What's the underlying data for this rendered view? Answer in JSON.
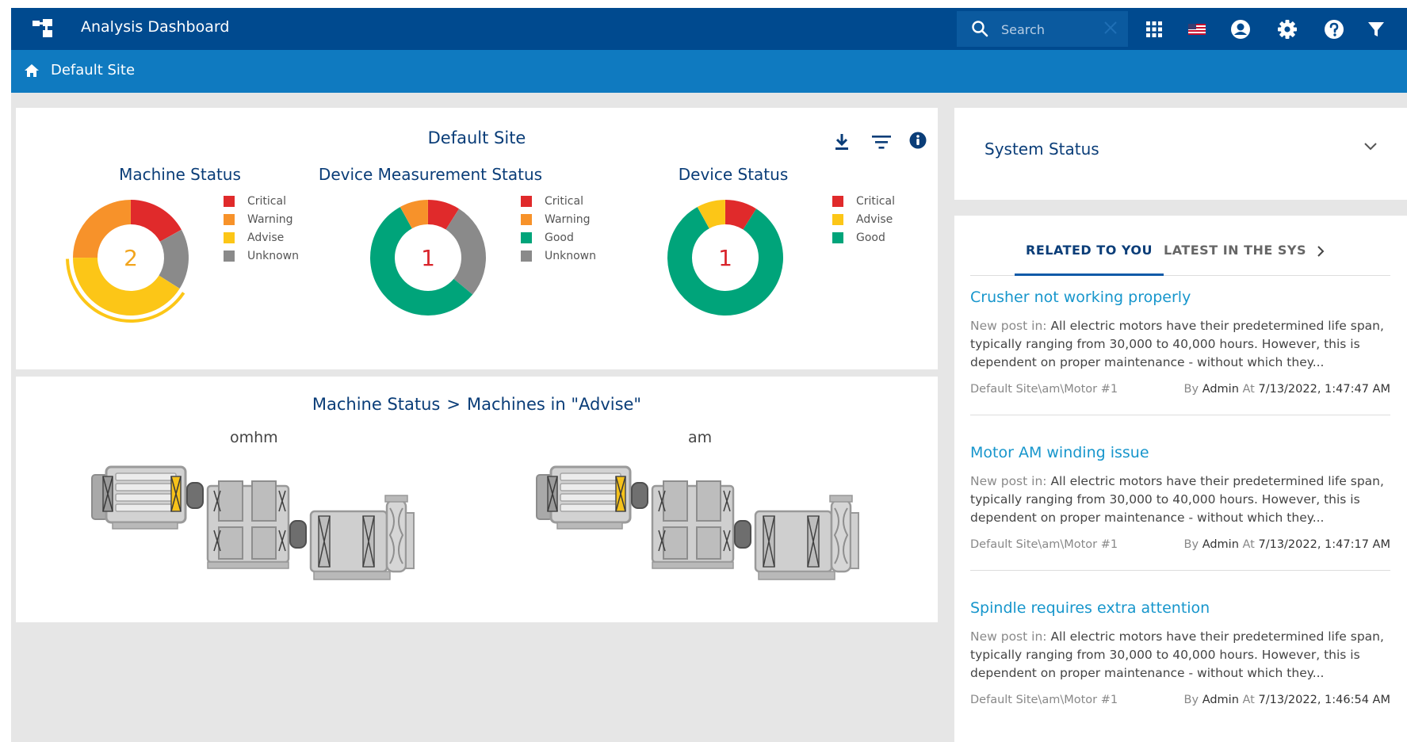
{
  "header": {
    "title": "Analysis Dashboard",
    "search_placeholder": "Search",
    "bg_color": "#004a8f",
    "icons": [
      "apps-grid-icon",
      "us-flag-icon",
      "user-account-icon",
      "gear-icon",
      "help-icon",
      "filter-icon"
    ]
  },
  "breadcrumb": {
    "label": "Default Site",
    "bg_color": "#0f7ac0"
  },
  "site_panel": {
    "title": "Default Site",
    "tool_icons": [
      "download-icon",
      "filter-lines-icon",
      "info-icon"
    ],
    "charts": [
      {
        "title": "Machine Status",
        "center_value": "2",
        "center_color": "#f2a51e",
        "legend": [
          "Critical",
          "Warning",
          "Advise",
          "Unknown"
        ]
      },
      {
        "title": "Device Measurement Status",
        "center_value": "1",
        "center_color": "#d9242b",
        "legend": [
          "Critical",
          "Warning",
          "Good",
          "Unknown"
        ]
      },
      {
        "title": "Device Status",
        "center_value": "1",
        "center_color": "#d9242b",
        "legend": [
          "Critical",
          "Advise",
          "Good"
        ]
      }
    ]
  },
  "status_colors": {
    "Critical": "#e02a2b",
    "Warning": "#f7922a",
    "Advise": "#fcc617",
    "Good": "#00a47a",
    "Unknown": "#8a8a8a"
  },
  "chart_data": [
    {
      "type": "pie",
      "title": "Machine Status",
      "center_label": "2",
      "highlighted_slice": "Advise",
      "slices": [
        {
          "label": "Critical",
          "value": 17
        },
        {
          "label": "Unknown",
          "value": 17
        },
        {
          "label": "Advise",
          "value": 41
        },
        {
          "label": "Warning",
          "value": 25
        }
      ]
    },
    {
      "type": "pie",
      "title": "Device Measurement Status",
      "center_label": "1",
      "slices": [
        {
          "label": "Critical",
          "value": 9
        },
        {
          "label": "Unknown",
          "value": 27
        },
        {
          "label": "Good",
          "value": 56
        },
        {
          "label": "Warning",
          "value": 8
        }
      ]
    },
    {
      "type": "pie",
      "title": "Device Status",
      "center_label": "1",
      "slices": [
        {
          "label": "Critical",
          "value": 9
        },
        {
          "label": "Good",
          "value": 83
        },
        {
          "label": "Advise",
          "value": 8
        }
      ]
    }
  ],
  "drilldown": {
    "part1": "Machine Status",
    "separator": ">",
    "part2": "Machines in \"Advise\"",
    "machines": [
      {
        "name": "omhm"
      },
      {
        "name": "am"
      }
    ]
  },
  "system_status": {
    "title": "System Status"
  },
  "news": {
    "tabs": [
      "RELATED TO YOU",
      "LATEST IN THE SYSTEM"
    ],
    "active_tab": 0,
    "posts": [
      {
        "title": "Crusher not working properly",
        "prefix": "New post in:",
        "body": "All electric motors have their predetermined life span, typically ranging from 30,000 to 40,000 hours. However, this is dependent on proper maintenance - without which they...",
        "path": "Default Site\\am\\Motor #1",
        "by_label": "By",
        "author": "Admin",
        "at_label": "At",
        "timestamp": "7/13/2022, 1:47:47 AM"
      },
      {
        "title": "Motor AM winding issue",
        "prefix": "New post in:",
        "body": "All electric motors have their predetermined life span, typically ranging from 30,000 to 40,000 hours. However, this is dependent on proper maintenance - without which they...",
        "path": "Default Site\\am\\Motor #1",
        "by_label": "By",
        "author": "Admin",
        "at_label": "At",
        "timestamp": "7/13/2022, 1:47:17 AM"
      },
      {
        "title": "Spindle requires extra attention",
        "prefix": "New post in:",
        "body": "All electric motors have their predetermined life span, typically ranging from 30,000 to 40,000 hours. However, this is dependent on proper maintenance - without which they...",
        "path": "Default Site\\am\\Motor #1",
        "by_label": "By",
        "author": "Admin",
        "at_label": "At",
        "timestamp": "7/13/2022, 1:46:54 AM"
      }
    ]
  }
}
